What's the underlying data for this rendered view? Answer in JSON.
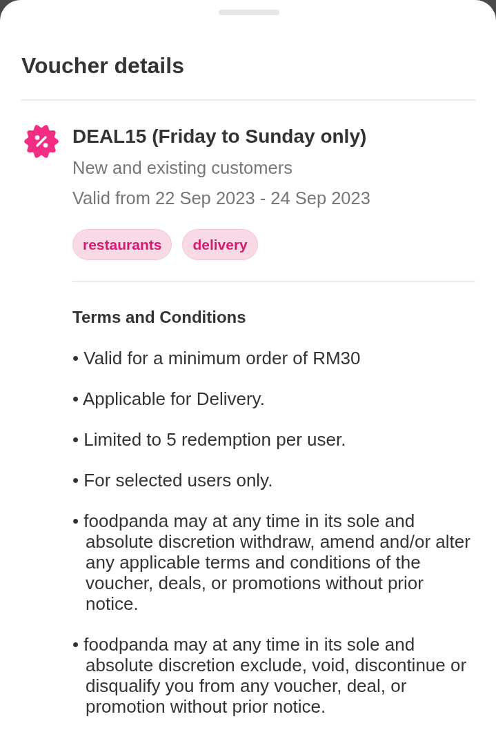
{
  "title": "Voucher details",
  "voucher": {
    "heading": "DEAL15 (Friday to Sunday only)",
    "audience": "New and existing customers",
    "validity": "Valid from 22 Sep 2023 - 24 Sep 2023",
    "tags": [
      "restaurants",
      "delivery"
    ]
  },
  "terms": {
    "heading": "Terms and Conditions",
    "items": [
      "• Valid for a minimum order of RM30",
      "• Applicable for Delivery.",
      "• Limited to 5 redemption per user.",
      "• For selected users only.",
      "• foodpanda may at any time in its sole and absolute discretion withdraw, amend and/or alter any applicable terms and conditions of the voucher, deals, or promotions without prior notice.",
      "• foodpanda may at any time in its sole and absolute discretion exclude, void, discontinue or disqualify you from any voucher, deal, or promotion without prior notice."
    ]
  }
}
